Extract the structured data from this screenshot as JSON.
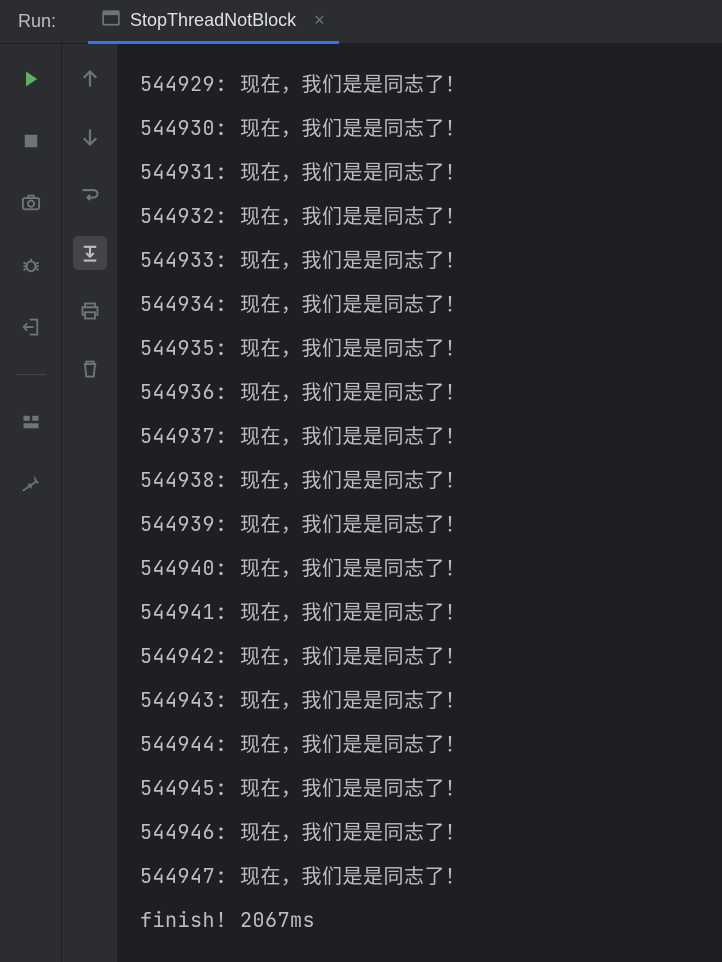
{
  "header": {
    "run_label": "Run:",
    "tab_title": "StopThreadNotBlock",
    "close_label": "×"
  },
  "toolbar_left": {
    "items": [
      {
        "name": "play-icon"
      },
      {
        "name": "stop-icon"
      },
      {
        "name": "camera-icon"
      },
      {
        "name": "debug-icon"
      },
      {
        "name": "exit-icon"
      }
    ],
    "bottom_items": [
      {
        "name": "panels-icon"
      },
      {
        "name": "pin-icon"
      }
    ]
  },
  "toolbar_second": {
    "items": [
      {
        "name": "arrow-up-icon"
      },
      {
        "name": "arrow-down-icon"
      },
      {
        "name": "soft-wrap-icon"
      },
      {
        "name": "scroll-to-end-icon"
      },
      {
        "name": "print-icon"
      },
      {
        "name": "trash-icon"
      }
    ]
  },
  "console": {
    "lines": [
      "544929: 现在，我们是是同志了！",
      "544930: 现在，我们是是同志了！",
      "544931: 现在，我们是是同志了！",
      "544932: 现在，我们是是同志了！",
      "544933: 现在，我们是是同志了！",
      "544934: 现在，我们是是同志了！",
      "544935: 现在，我们是是同志了！",
      "544936: 现在，我们是是同志了！",
      "544937: 现在，我们是是同志了！",
      "544938: 现在，我们是是同志了！",
      "544939: 现在，我们是是同志了！",
      "544940: 现在，我们是是同志了！",
      "544941: 现在，我们是是同志了！",
      "544942: 现在，我们是是同志了！",
      "544943: 现在，我们是是同志了！",
      "544944: 现在，我们是是同志了！",
      "544945: 现在，我们是是同志了！",
      "544946: 现在，我们是是同志了！",
      "544947: 现在，我们是是同志了！",
      "finish! 2067ms"
    ]
  }
}
